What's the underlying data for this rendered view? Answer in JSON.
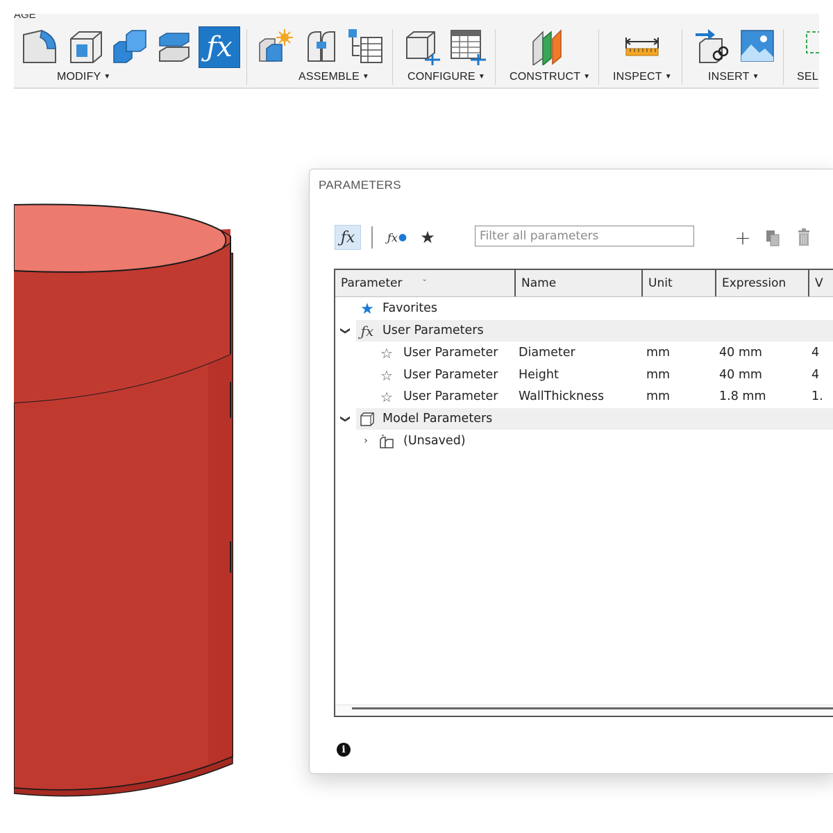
{
  "toolbar": {
    "partial_tab_label": "AGE",
    "groups": [
      {
        "label": "MODIFY",
        "icons": [
          "press-pull-icon",
          "shell-icon",
          "combine-icon",
          "offset-face-icon",
          "change-parameters-icon"
        ]
      },
      {
        "label": "ASSEMBLE",
        "icons": [
          "new-component-icon",
          "joint-icon",
          "bill-of-materials-icon"
        ]
      },
      {
        "label": "CONFIGURE",
        "icons": [
          "configure-component-icon",
          "configure-table-icon"
        ]
      },
      {
        "label": "CONSTRUCT",
        "icons": [
          "offset-plane-icon"
        ]
      },
      {
        "label": "INSPECT",
        "icons": [
          "measure-icon"
        ]
      },
      {
        "label": "INSERT",
        "icons": [
          "insert-derive-icon",
          "insert-canvas-icon"
        ]
      },
      {
        "label": "SELE",
        "icons": [
          "select-icon"
        ]
      }
    ]
  },
  "dialog": {
    "title": "PARAMETERS",
    "filter_placeholder": "Filter all parameters",
    "columns": [
      "Parameter",
      "Name",
      "Unit",
      "Expression",
      "V"
    ],
    "favorites_label": "Favorites",
    "user_params_label": "User Parameters",
    "user_params": [
      {
        "parameter": "User Parameter",
        "name": "Diameter",
        "unit": "mm",
        "expression": "40 mm",
        "value": "4"
      },
      {
        "parameter": "User Parameter",
        "name": "Height",
        "unit": "mm",
        "expression": "40 mm",
        "value": "4"
      },
      {
        "parameter": "User Parameter",
        "name": "WallThickness",
        "unit": "mm",
        "expression": "1.8 mm",
        "value": "1."
      }
    ],
    "model_params_label": "Model Parameters",
    "unsaved_label": "(Unsaved)"
  },
  "colors": {
    "accent_blue": "#1a7ad4",
    "model_body": "#c0392f",
    "model_top": "#ec7a6e"
  }
}
